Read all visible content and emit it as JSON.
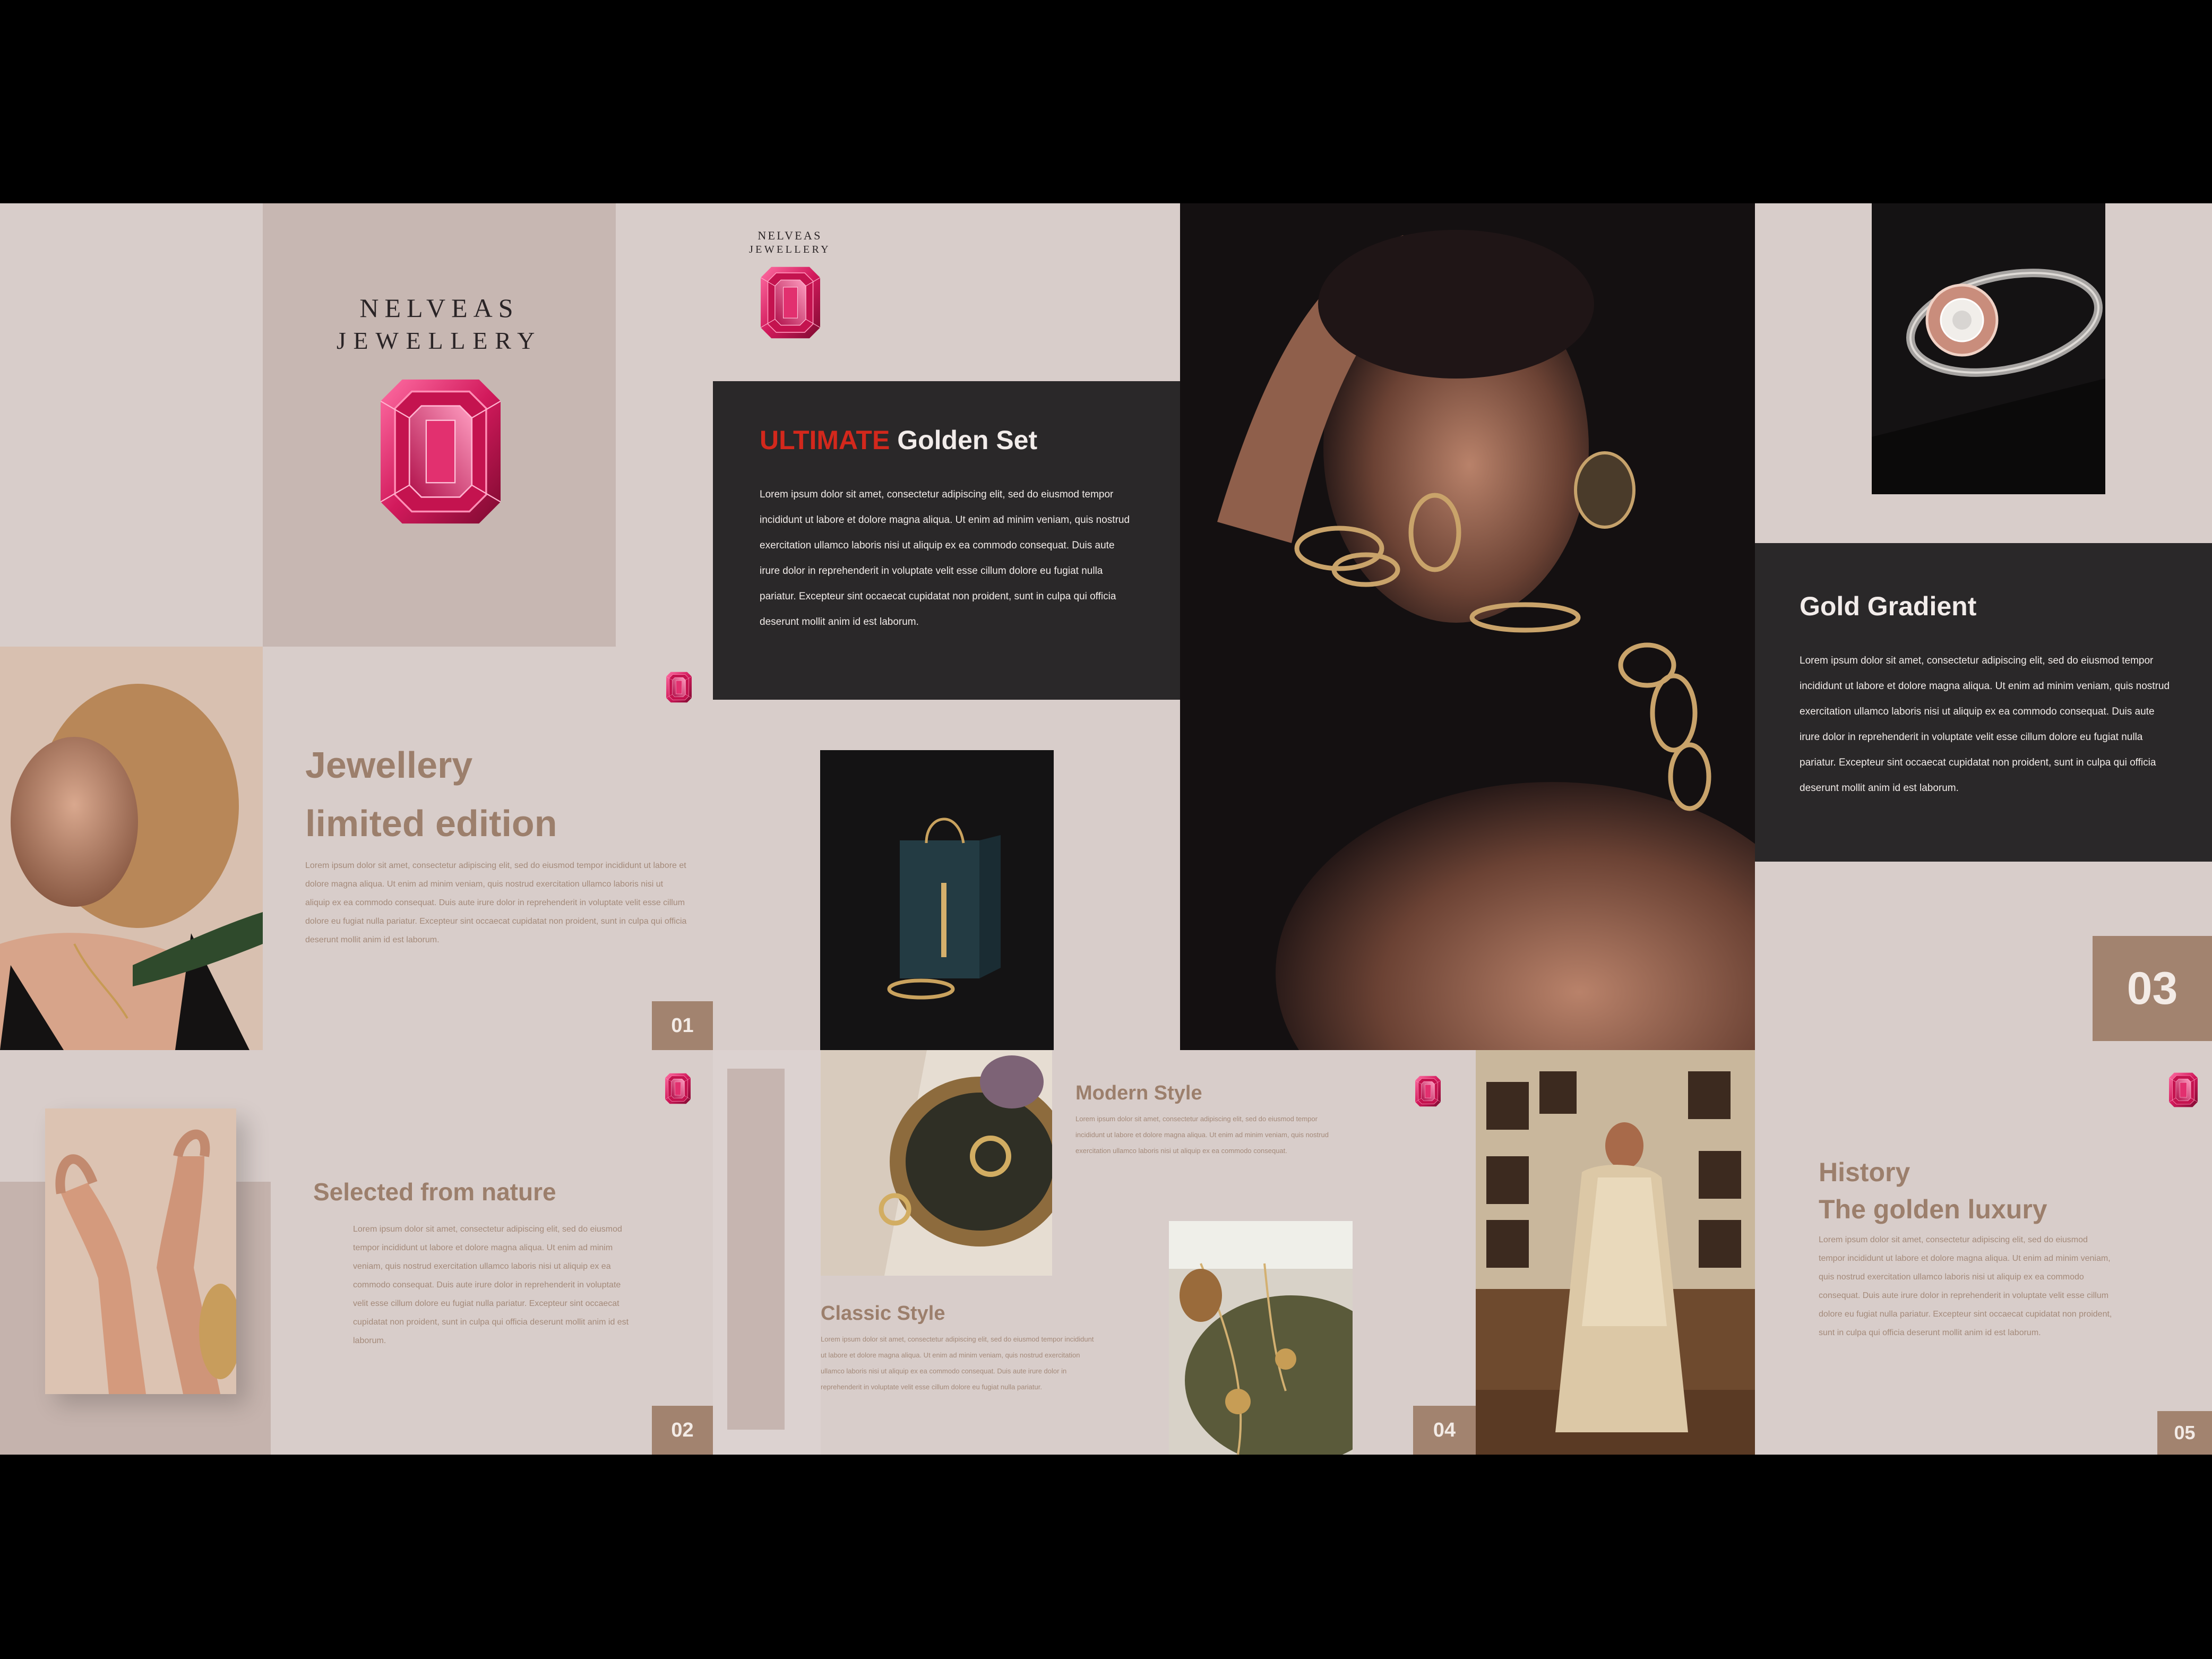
{
  "brand": {
    "name_line1": "NELVEAS",
    "name_line2": "JEWELLERY"
  },
  "cover": {
    "title_accent": "ULTIMATE",
    "title_rest": "Golden Set",
    "body": "Lorem ipsum dolor sit amet, consectetur adipiscing elit, sed do eiusmod tempor incididunt ut labore et dolore magna aliqua. Ut enim ad minim veniam, quis nostrud exercitation ullamco laboris nisi ut aliquip ex ea commodo consequat. Duis aute irure dolor in reprehenderit in voluptate velit esse cillum dolore eu fugiat nulla pariatur. Excepteur sint occaecat cupidatat non proident, sunt in culpa qui officia deserunt mollit anim id est laborum."
  },
  "slide1": {
    "title_line1": "Jewellery",
    "title_line2": "limited edition",
    "body": "Lorem ipsum dolor sit amet, consectetur adipiscing elit, sed do eiusmod tempor incididunt ut labore et dolore magna aliqua. Ut enim ad minim veniam, quis nostrud exercitation ullamco laboris nisi ut aliquip ex ea commodo consequat. Duis aute irure dolor in reprehenderit in voluptate velit esse cillum dolore eu fugiat nulla pariatur. Excepteur sint occaecat cupidatat non proident, sunt in culpa qui officia deserunt mollit anim id est laborum.",
    "number": "01"
  },
  "slide2": {
    "title": "Selected from nature",
    "body": "Lorem ipsum dolor sit amet, consectetur adipiscing elit, sed do eiusmod tempor incididunt ut labore et dolore magna aliqua. Ut enim ad minim veniam, quis nostrud exercitation ullamco laboris nisi ut aliquip ex ea commodo consequat. Duis aute irure dolor in reprehenderit in voluptate velit esse cillum dolore eu fugiat nulla pariatur. Excepteur sint occaecat cupidatat non proident, sunt in culpa qui officia deserunt mollit anim id est laborum.",
    "number": "02"
  },
  "slide3": {
    "title": "Gold Gradient",
    "body": "Lorem ipsum dolor sit amet, consectetur adipiscing elit, sed do eiusmod tempor incididunt ut labore et dolore magna aliqua. Ut enim ad minim veniam, quis nostrud exercitation ullamco laboris nisi ut aliquip ex ea commodo consequat. Duis aute irure dolor in reprehenderit in voluptate velit esse cillum dolore eu fugiat nulla pariatur. Excepteur sint occaecat cupidatat non proident, sunt in culpa qui officia deserunt mollit anim id est laborum.",
    "number": "03"
  },
  "slide4": {
    "modern_title": "Modern Style",
    "modern_body": "Lorem ipsum dolor sit amet, consectetur adipiscing elit, sed do eiusmod tempor incididunt ut labore et dolore magna aliqua. Ut enim ad minim veniam, quis nostrud exercitation ullamco laboris nisi ut aliquip ex ea commodo consequat.",
    "classic_title": "Classic Style",
    "classic_body": "Lorem ipsum dolor sit amet, consectetur adipiscing elit, sed do eiusmod tempor incididunt ut labore et dolore magna aliqua. Ut enim ad minim veniam, quis nostrud exercitation ullamco laboris nisi ut aliquip ex ea commodo consequat. Duis aute irure dolor in reprehenderit in voluptate velit esse cillum dolore eu fugiat nulla pariatur.",
    "number": "04"
  },
  "slide5": {
    "title_line1": "History",
    "title_line2": "The golden luxury",
    "body": "Lorem ipsum dolor sit amet, consectetur adipiscing elit, sed do eiusmod tempor incididunt ut labore et dolore magna aliqua. Ut enim ad minim veniam, quis nostrud exercitation ullamco laboris nisi ut aliquip ex ea commodo consequat. Duis aute irure dolor in reprehenderit in voluptate velit esse cillum dolore eu fugiat nulla pariatur. Excepteur sint occaecat cupidatat non proident, sunt in culpa qui officia deserunt mollit anim id est laborum.",
    "number": "05"
  },
  "colors": {
    "background": "#000000",
    "panel": "#d8cdca",
    "taupe": "#c7b7b2",
    "dark_panel": "#2a2829",
    "accent_brown": "#a2836f",
    "accent_red": "#d3281c",
    "gem_pink": "#e0306e"
  },
  "icons": [
    "gem-icon",
    "ring-photo",
    "necklace-photo"
  ]
}
